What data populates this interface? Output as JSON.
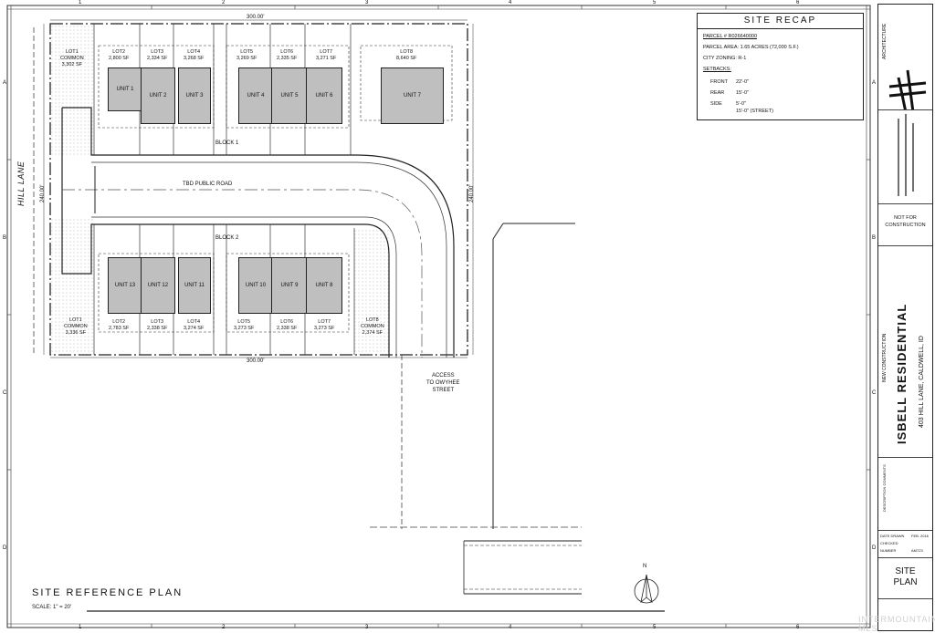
{
  "plan_title": "SITE REFERENCE PLAN",
  "scale": "SCALE: 1\" = 20'",
  "street_left": "HILL LANE",
  "road_label": "TBD PUBLIC ROAD",
  "access_label": [
    "ACCESS",
    "TO OWYHEE",
    "STREET"
  ],
  "dims": {
    "top": "300.00'",
    "bottom": "300.00'",
    "left": "240.00'",
    "right": "240.00'"
  },
  "blocks": {
    "block1": "BLOCK 1",
    "block2": "BLOCK 2"
  },
  "grid_cols": [
    "1",
    "2",
    "3",
    "4",
    "5",
    "6"
  ],
  "grid_rows": [
    "A",
    "B",
    "C",
    "D"
  ],
  "top_lots": [
    {
      "name": "LOT1",
      "sub": "COMMON",
      "area": "3,302 SF"
    },
    {
      "name": "LOT2",
      "area": "2,800 SF"
    },
    {
      "name": "LOT3",
      "area": "2,334 SF"
    },
    {
      "name": "LOT4",
      "area": "3,268 SF"
    },
    {
      "name": "LOT5",
      "area": "3,269 SF"
    },
    {
      "name": "LOT6",
      "area": "2,335 SF"
    },
    {
      "name": "LOT7",
      "area": "3,271 SF"
    },
    {
      "name": "LOT8",
      "area": "8,640 SF"
    }
  ],
  "bottom_lots": [
    {
      "name": "LOT1",
      "sub": "COMMON",
      "area": "3,336 SF"
    },
    {
      "name": "LOT2",
      "area": "2,783 SF"
    },
    {
      "name": "LOT3",
      "area": "2,338 SF"
    },
    {
      "name": "LOT4",
      "area": "3,274 SF"
    },
    {
      "name": "LOT5",
      "area": "3,273 SF"
    },
    {
      "name": "LOT6",
      "area": "2,338 SF"
    },
    {
      "name": "LOT7",
      "area": "3,273 SF"
    },
    {
      "name": "LOT8",
      "sub": "COMMON",
      "area": "2,374 SF"
    }
  ],
  "top_units": [
    "UNIT 1",
    "UNIT 2",
    "UNIT 3",
    "UNIT 4",
    "UNIT 5",
    "UNIT 6",
    "UNIT 7"
  ],
  "bottom_units": [
    "UNIT 13",
    "UNIT 12",
    "UNIT 11",
    "UNIT 10",
    "UNIT 9",
    "UNIT 8"
  ],
  "recap": {
    "title": "SITE RECAP",
    "parcel": "PARCEL # R026640000",
    "parcel_area": "PARCEL AREA: 1.65 ACRES (72,000 S.F.)",
    "zoning": "CITY ZONING: R-1",
    "setbacks": "SETBACKS:",
    "front": "FRONT",
    "front_val": "22'-0\"",
    "rear": "REAR",
    "rear_val": "15'-0\"",
    "side": "SIDE",
    "side_val1": "5'-0\"",
    "side_val2": "15'-0\" (STREET)"
  },
  "titleblock": {
    "firm": "ARCHITECTURE",
    "not_for_construction": "NOT FOR CONSTRUCTION",
    "new_construction": "NEW CONSTRUCTION",
    "project": "ISBELL RESIDENTIAL",
    "address": "403 HILL LANE, CALDWELL, ID",
    "sheet_title": [
      "SITE",
      "PLAN"
    ],
    "date_drawn": "DATE DRAWN",
    "date_val": "FEB. 2016",
    "checked": "CHECKED",
    "number": "NUMBER",
    "number_val": "AM723",
    "revisions": "DESCRIPTION COMMENTS"
  },
  "watermark": "INTERMOUNTAIN MLS"
}
